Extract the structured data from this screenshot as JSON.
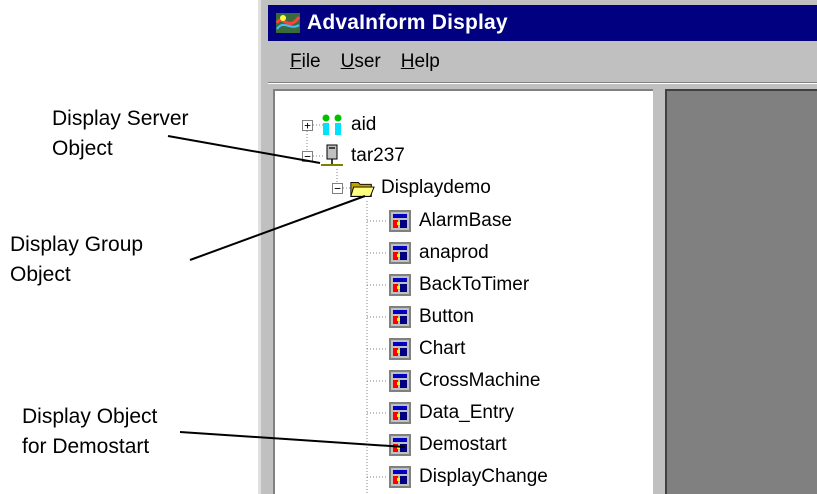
{
  "annotations": [
    {
      "line1": "Display Server",
      "line2": "Object"
    },
    {
      "line1": "Display Group",
      "line2": "Object"
    },
    {
      "line1": "Display Object",
      "line2": "for Demostart"
    }
  ],
  "window": {
    "title": "AdvaInform Display",
    "title_bar_color": "#000080",
    "app_icon": "advainform-app-icon"
  },
  "menu": {
    "items": [
      {
        "accel": "F",
        "rest": "ile"
      },
      {
        "accel": "U",
        "rest": "ser"
      },
      {
        "accel": "H",
        "rest": "elp"
      }
    ]
  },
  "tree": {
    "roots": [
      {
        "label": "aid",
        "icon": "users-icon",
        "expander": "+"
      },
      {
        "label": "tar237",
        "icon": "network-computer-icon",
        "expander": "−"
      }
    ],
    "group": {
      "label": "Displaydemo",
      "icon": "open-folder-icon",
      "expander": "−"
    },
    "displays": [
      {
        "label": "AlarmBase"
      },
      {
        "label": "anaprod"
      },
      {
        "label": "BackToTimer"
      },
      {
        "label": "Button"
      },
      {
        "label": "Chart"
      },
      {
        "label": "CrossMachine"
      },
      {
        "label": "Data_Entry"
      },
      {
        "label": "Demostart"
      },
      {
        "label": "DisplayChange"
      }
    ],
    "display_icon": "display-icon"
  }
}
